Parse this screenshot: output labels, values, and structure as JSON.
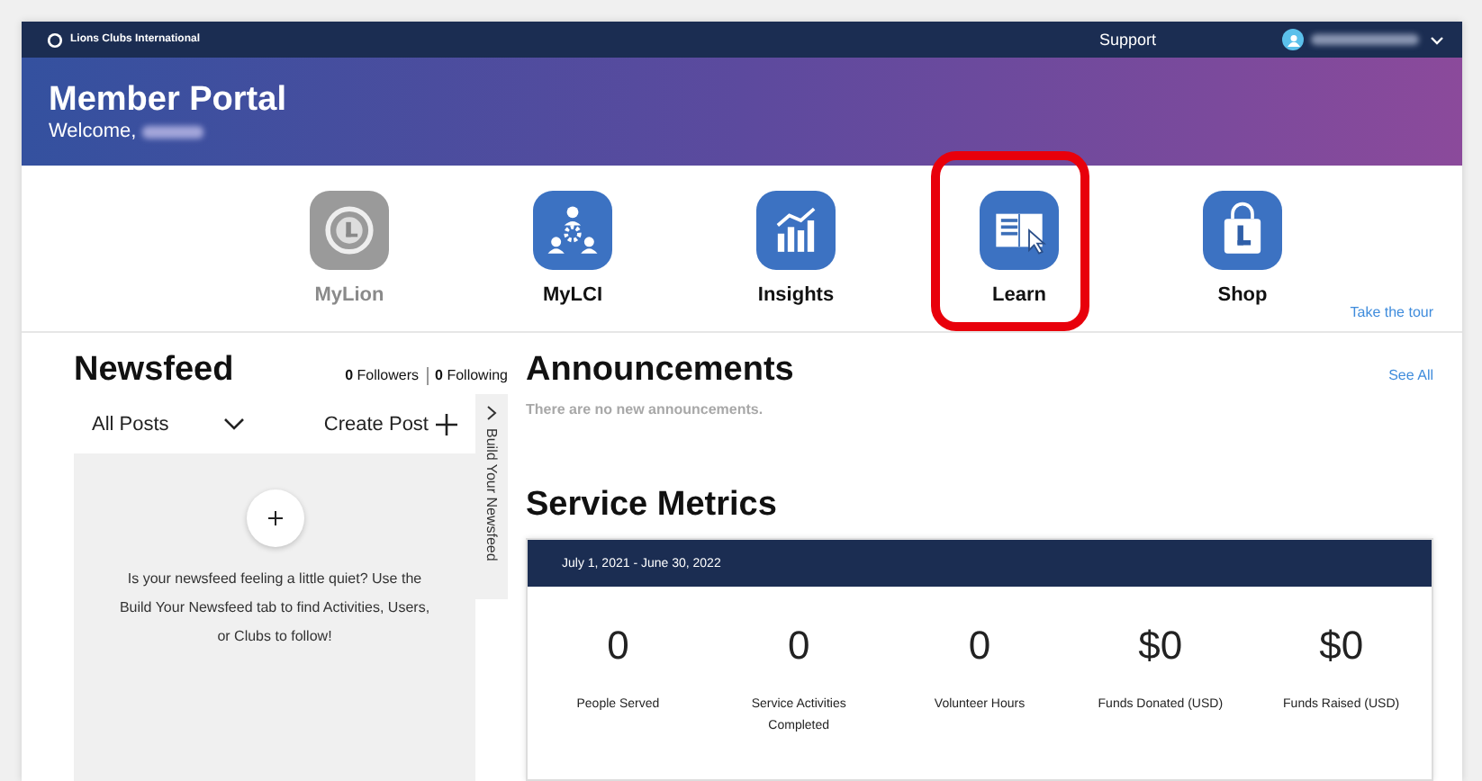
{
  "top_bar": {
    "brand": "Lions Clubs International",
    "support": "Support"
  },
  "header": {
    "title": "Member Portal",
    "welcome": "Welcome,"
  },
  "apps": [
    {
      "label": "MyLion",
      "kind": "lion",
      "disabled": true,
      "highlighted": false
    },
    {
      "label": "MyLCI",
      "kind": "people",
      "disabled": false,
      "highlighted": false
    },
    {
      "label": "Insights",
      "kind": "chart",
      "disabled": false,
      "highlighted": false
    },
    {
      "label": "Learn",
      "kind": "book",
      "disabled": false,
      "highlighted": true
    },
    {
      "label": "Shop",
      "kind": "bag",
      "disabled": false,
      "highlighted": false
    }
  ],
  "tour_link": "Take the tour",
  "newsfeed": {
    "title": "Newsfeed",
    "followers_count": "0",
    "followers_label": "Followers",
    "following_count": "0",
    "following_label": "Following",
    "filter": "All Posts",
    "create_post": "Create Post",
    "side_tab": "Build Your Newsfeed",
    "empty_message": "Is your newsfeed feeling a little quiet? Use the Build Your Newsfeed tab to find Activities, Users, or Clubs to follow!"
  },
  "announcements": {
    "title": "Announcements",
    "see_all": "See All",
    "empty_message": "There are no new announcements."
  },
  "service_metrics": {
    "title": "Service Metrics",
    "period": "July 1, 2021 - June 30, 2022",
    "metrics": [
      {
        "value": "0",
        "label": "People Served"
      },
      {
        "value": "0",
        "label": "Service Activities Completed"
      },
      {
        "value": "0",
        "label": "Volunteer Hours"
      },
      {
        "value": "$0",
        "label": "Funds Donated (USD)"
      },
      {
        "value": "$0",
        "label": "Funds Raised (USD)"
      }
    ]
  }
}
